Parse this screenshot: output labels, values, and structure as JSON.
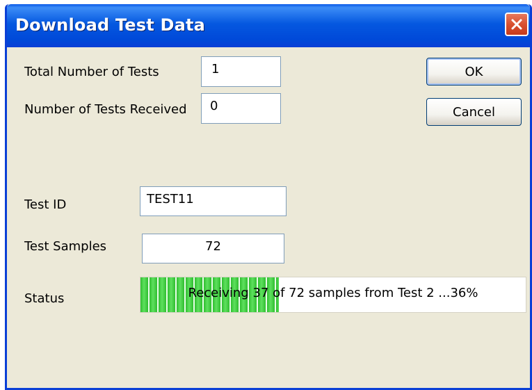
{
  "window": {
    "title": "Download Test Data",
    "close_icon": "close-icon"
  },
  "fields": {
    "total_tests": {
      "label": "Total Number of Tests",
      "value": "1"
    },
    "tests_received": {
      "label": "Number of Tests Received",
      "value": "0"
    },
    "test_id": {
      "label": "Test ID",
      "value": "TEST11"
    },
    "test_samples": {
      "label": "Test Samples",
      "value": "72"
    }
  },
  "buttons": {
    "ok": "OK",
    "cancel": "Cancel"
  },
  "status": {
    "label": "Status",
    "progress_text": "Receiving 37 of 72 samples from Test 2 ...36%",
    "progress_fraction": 0.36
  },
  "colors": {
    "titlebar": "#0558e0",
    "close_button": "#d9512f",
    "progress_fill": "#2fbe2f",
    "dialog_background": "#ece9d8"
  }
}
